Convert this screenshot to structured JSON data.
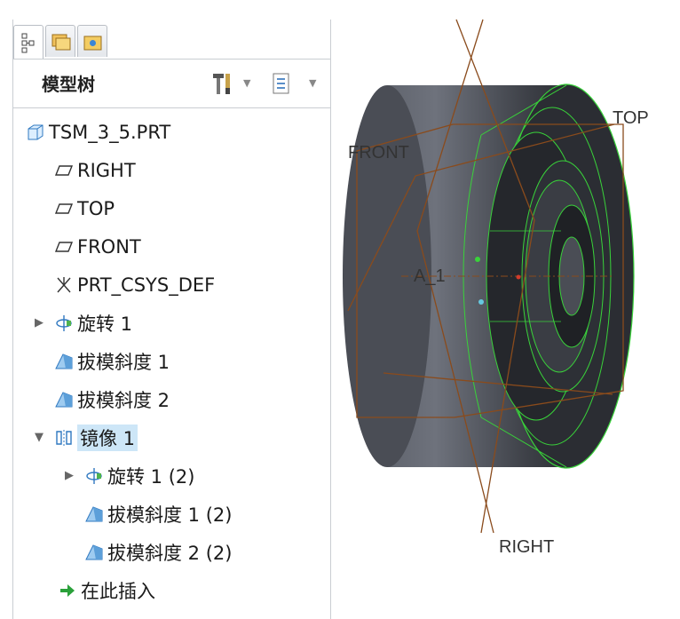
{
  "panel": {
    "title": "模型树",
    "tabs": [
      "model-tree-tab",
      "folder-browser-tab",
      "favorites-tab"
    ]
  },
  "tree": {
    "root": "TSM_3_5.PRT",
    "items": [
      {
        "label": "RIGHT",
        "icon": "datum-plane-icon"
      },
      {
        "label": "TOP",
        "icon": "datum-plane-icon"
      },
      {
        "label": "FRONT",
        "icon": "datum-plane-icon"
      },
      {
        "label": "PRT_CSYS_DEF",
        "icon": "csys-icon"
      },
      {
        "label": "旋转 1",
        "icon": "revolve-icon"
      },
      {
        "label": "拔模斜度 1",
        "icon": "draft-icon"
      },
      {
        "label": "拔模斜度 2",
        "icon": "draft-icon"
      },
      {
        "label": "镜像 1",
        "icon": "mirror-icon"
      },
      {
        "label": "旋转 1 (2)",
        "icon": "revolve-icon"
      },
      {
        "label": "拔模斜度 1 (2)",
        "icon": "draft-icon"
      },
      {
        "label": "拔模斜度 2 (2)",
        "icon": "draft-icon"
      },
      {
        "label": "在此插入",
        "icon": "insert-arrow-icon"
      }
    ]
  },
  "viewport": {
    "labels": {
      "front": "FRONT",
      "top": "TOP",
      "right": "RIGHT",
      "axis": "A_1"
    },
    "colors": {
      "datum": "#8a4b1c",
      "edge": "#39d23a",
      "body": "#3c3f46"
    }
  }
}
